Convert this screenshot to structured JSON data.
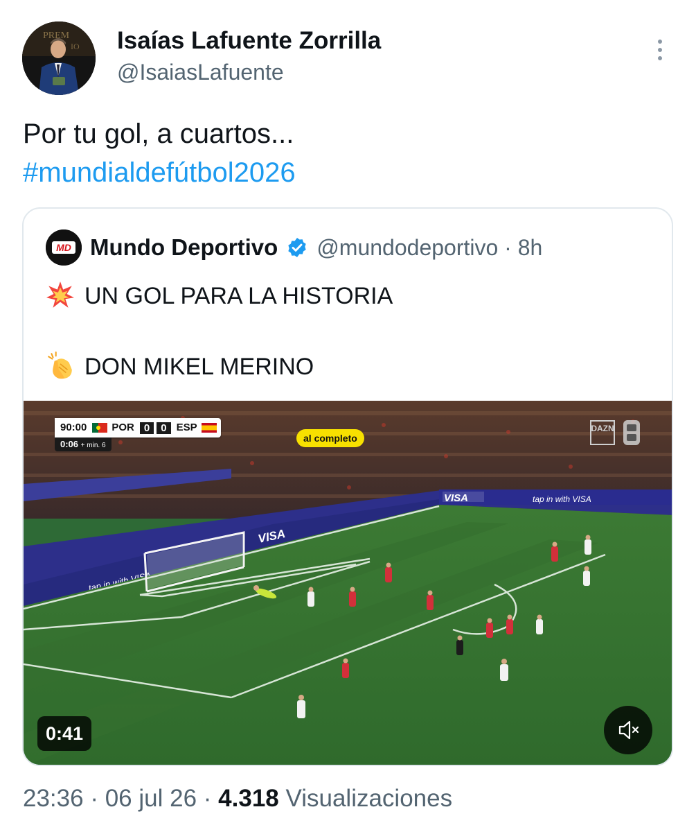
{
  "author": {
    "display_name": "Isaías Lafuente Zorrilla",
    "handle": "@IsaiasLafuente",
    "avatar_icon": "profile-photo-man-in-suit"
  },
  "more_options_icon": "vertical-dots-icon",
  "tweet": {
    "text": "Por tu gol, a cuartos...",
    "hashtag": "#mundialdefútbol2026",
    "hashtag_color": "#1d9bf0"
  },
  "quoted_tweet": {
    "avatar_text": "MD",
    "display_name": "Mundo Deportivo",
    "verified_color": "#1d9bf0",
    "handle": "@mundodeportivo",
    "separator": "·",
    "time": "8h",
    "lines": [
      {
        "emoji": "collision-emoji",
        "text": "UN GOL PARA LA HISTORIA"
      },
      {
        "emoji": "clapping-hands-emoji",
        "text": "DON MIKEL MERINO"
      }
    ],
    "video": {
      "scoreboard": {
        "clock": "90:00",
        "home_team": "POR",
        "home_score": "0",
        "away_score": "0",
        "away_team": "ESP",
        "extra_time": "0:06",
        "extra_label": "+ min. 6"
      },
      "tag": "al completo",
      "broadcaster": "DAZN",
      "pitch_ad": "VISA",
      "pitch_ad_2": "tap in with VISA",
      "duration": "0:41",
      "mute_icon": "speaker-muted-icon"
    }
  },
  "meta": {
    "time": "23:36",
    "date": "06 jul 26",
    "separator": "·",
    "views_count": "4.318",
    "views_label": "Visualizaciones"
  }
}
